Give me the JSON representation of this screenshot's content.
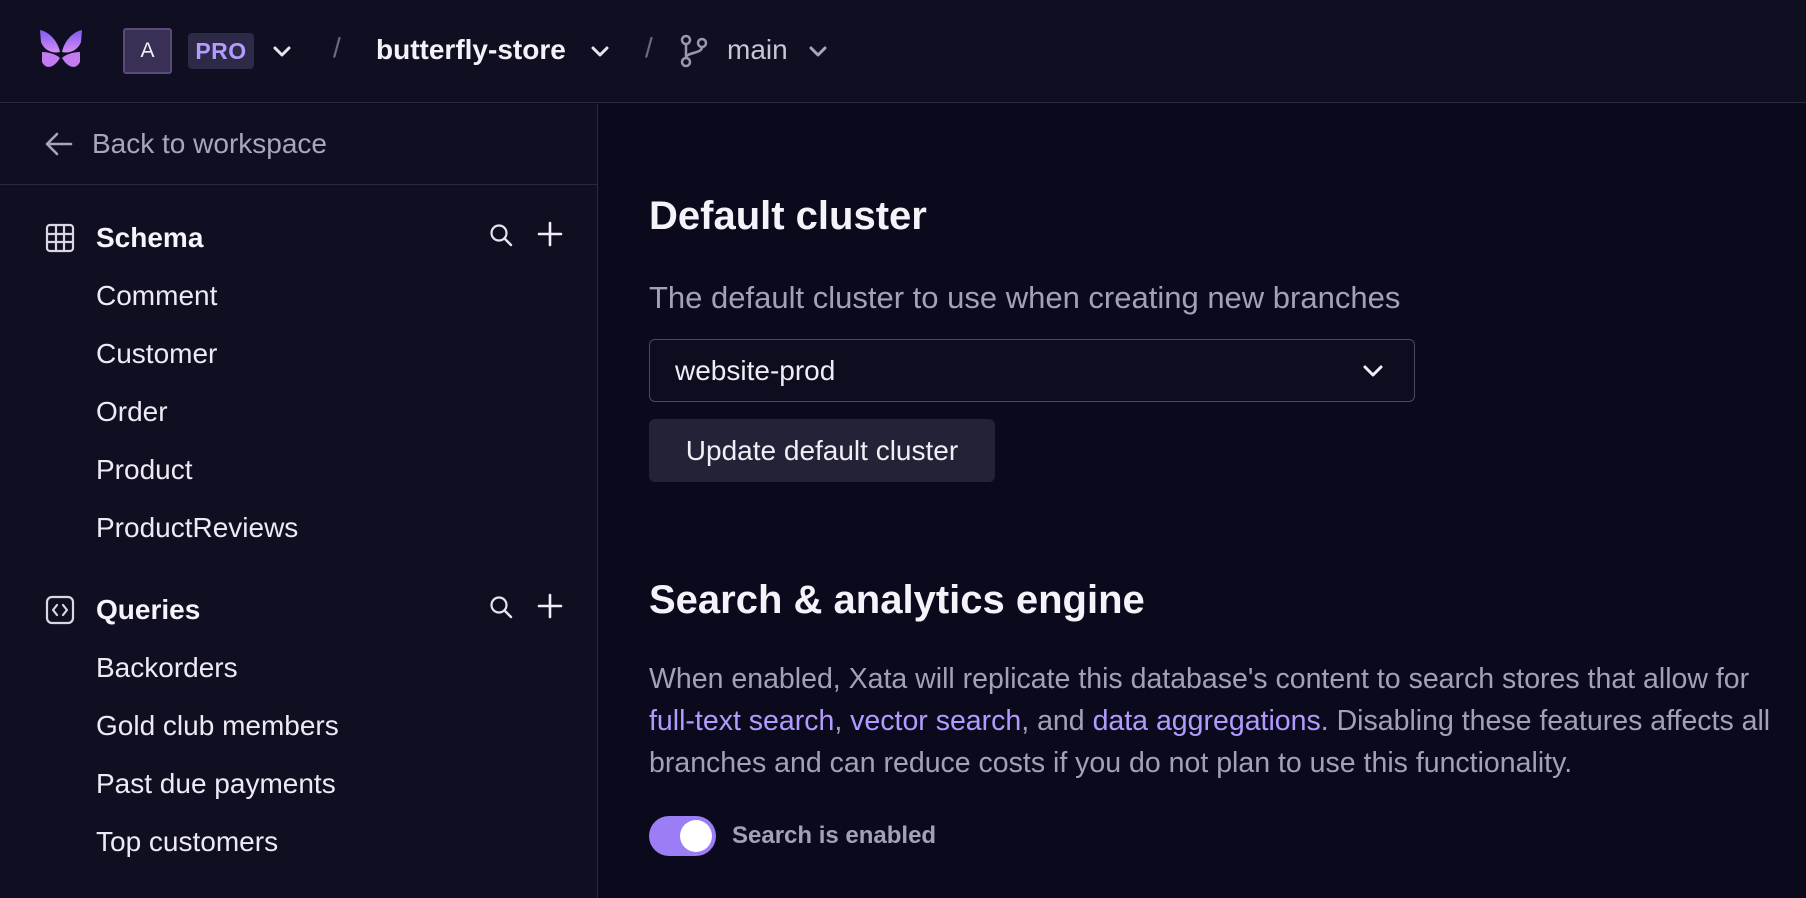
{
  "header": {
    "workspace_initial": "A",
    "plan_badge": "PRO",
    "separator": "/",
    "database_name": "butterfly-store",
    "branch_name": "main"
  },
  "sidebar": {
    "back_label": "Back to workspace",
    "schema": {
      "title": "Schema",
      "items": [
        "Comment",
        "Customer",
        "Order",
        "Product",
        "ProductReviews"
      ]
    },
    "queries": {
      "title": "Queries",
      "items": [
        "Backorders",
        "Gold club members",
        "Past due payments",
        "Top customers"
      ]
    }
  },
  "main": {
    "default_cluster": {
      "heading": "Default cluster",
      "description": "The default cluster to use when creating new branches",
      "selected_value": "website-prod",
      "update_button": "Update default cluster"
    },
    "search_engine": {
      "heading": "Search & analytics engine",
      "text_1": "When enabled, Xata will replicate this database's content to search stores that allow for ",
      "link_full_text": "full-text search",
      "text_2": ", ",
      "link_vector": "vector search",
      "text_3": ", and ",
      "link_aggregations": "data aggregations",
      "text_4": ". Disabling these features affects all branches and can reduce costs if you do not plan to use this functionality.",
      "toggle_label": "Search is enabled",
      "toggle_on": true
    }
  },
  "colors": {
    "accent": "#9b7ef5",
    "link": "#b29bff",
    "background": "#0b0a1c",
    "sidebar": "#100f22"
  },
  "icons": [
    "butterfly-logo-icon",
    "chevron-down-icon",
    "git-branch-icon",
    "arrow-left-icon",
    "table-grid-icon",
    "code-icon",
    "search-icon",
    "plus-icon"
  ]
}
